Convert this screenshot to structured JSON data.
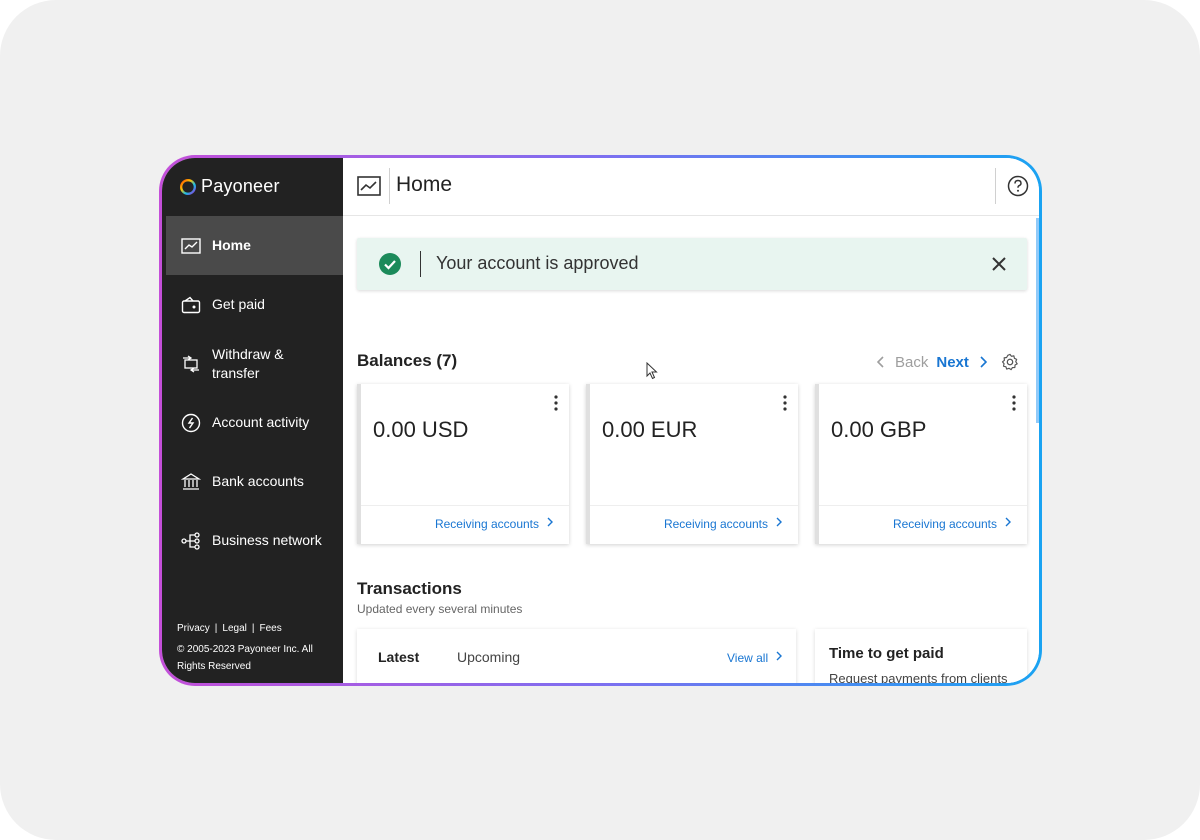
{
  "brand": {
    "name": "Payoneer"
  },
  "sidebar": {
    "items": [
      {
        "label": "Home",
        "icon": "chart-window-icon",
        "active": true
      },
      {
        "label": "Get paid",
        "icon": "wallet-icon"
      },
      {
        "label": "Withdraw & transfer",
        "icon": "transfer-icon"
      },
      {
        "label": "Account activity",
        "icon": "activity-icon"
      },
      {
        "label": "Bank accounts",
        "icon": "bank-icon"
      },
      {
        "label": "Business network",
        "icon": "network-icon"
      }
    ],
    "footer": {
      "links": [
        "Privacy",
        "|",
        "Legal",
        "|",
        "Fees"
      ],
      "copyright": "© 2005-2023 Payoneer Inc. All Rights Reserved"
    }
  },
  "header": {
    "title": "Home"
  },
  "alert": {
    "text": "Your account is approved",
    "status_color": "#1b8a5a"
  },
  "balances": {
    "title": "Balances (7)",
    "back_label": "Back",
    "next_label": "Next",
    "cards": [
      {
        "amount": "0.00 USD",
        "link": "Receiving accounts"
      },
      {
        "amount": "0.00 EUR",
        "link": "Receiving accounts"
      },
      {
        "amount": "0.00 GBP",
        "link": "Receiving accounts"
      }
    ]
  },
  "transactions": {
    "title": "Transactions",
    "subtitle": "Updated every several minutes",
    "tabs": [
      "Latest",
      "Upcoming"
    ],
    "view_all": "View all"
  },
  "promo": {
    "title": "Time to get paid",
    "subtitle": "Request payments from clients"
  },
  "colors": {
    "accent": "#1976d2",
    "sidebar": "#222222",
    "alert_bg": "#e8f5f0"
  }
}
